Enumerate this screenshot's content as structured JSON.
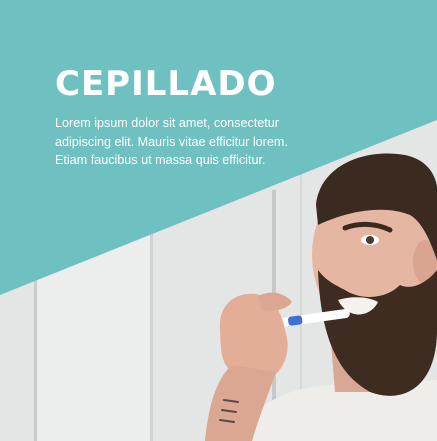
{
  "hero": {
    "title": "CEPILLADO",
    "description": "Lorem ipsum dolor sit amet, consectetur adipiscing elit. Mauris vitae efficitur lorem. Etiam faucibus ut massa quis efficitur."
  },
  "colors": {
    "accent": "#6fc1c1",
    "wall": "#e3e5e5",
    "shirt": "#ecebe7",
    "skin": "#e7b8a4",
    "beard": "#3b2a20",
    "toothbrush": "#ffffff"
  },
  "icons": {
    "photo": "man-brushing-teeth-photo"
  }
}
